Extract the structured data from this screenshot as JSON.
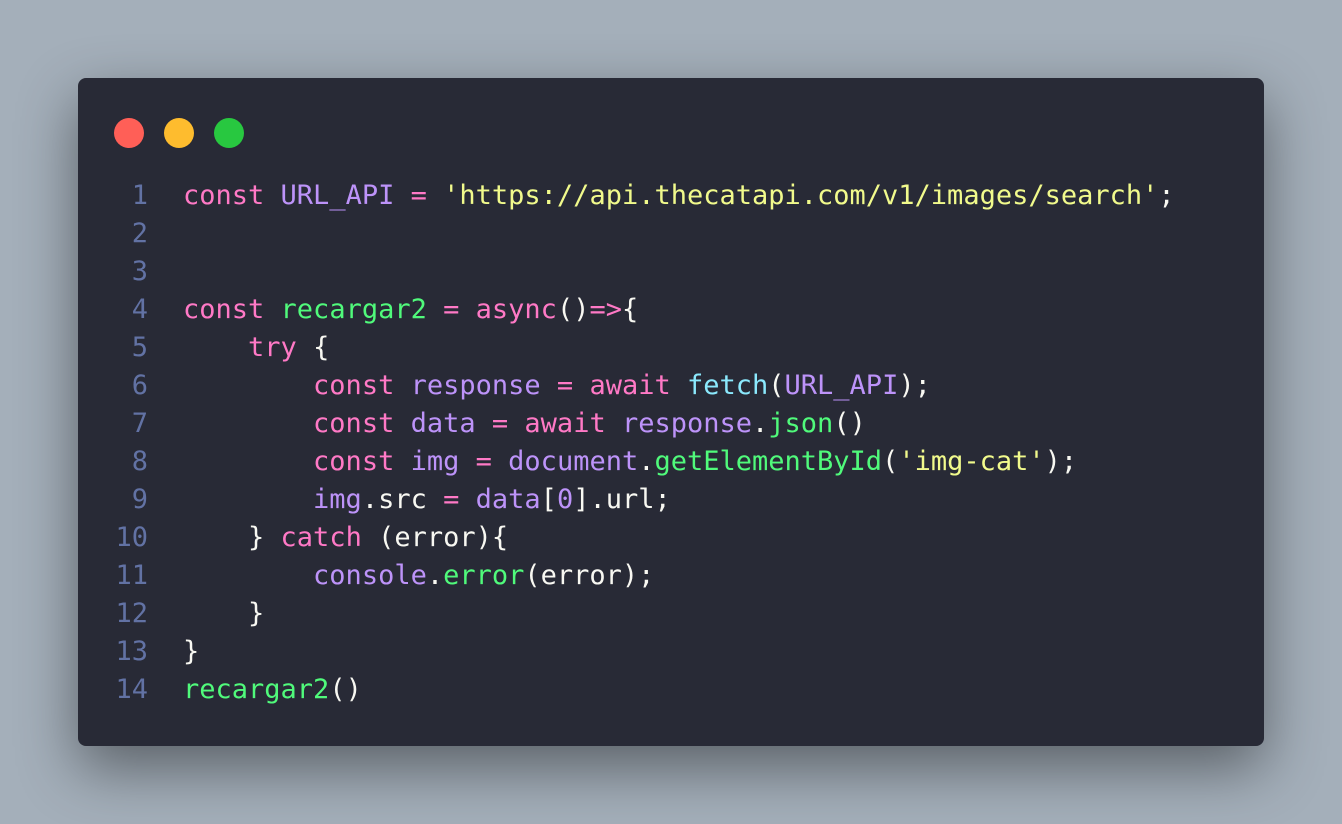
{
  "window": {
    "dots": [
      {
        "name": "close-dot",
        "color": "#ff5f57"
      },
      {
        "name": "minimize-dot",
        "color": "#febc2e"
      },
      {
        "name": "maximize-dot",
        "color": "#28c840"
      }
    ]
  },
  "theme": {
    "background": "#282a36",
    "line_number": "#6272a4",
    "default": "#f8f8f2",
    "keyword": "#ff79c6",
    "variable": "#bd93f9",
    "string": "#f1fa8c",
    "function": "#50fa7b",
    "builtin": "#8be9fd"
  },
  "code": {
    "lines": [
      {
        "n": "1",
        "tokens": [
          {
            "t": "const",
            "c": "keyword"
          },
          {
            "t": " ",
            "c": "default"
          },
          {
            "t": "URL_API",
            "c": "variable"
          },
          {
            "t": " ",
            "c": "default"
          },
          {
            "t": "=",
            "c": "keyword"
          },
          {
            "t": " ",
            "c": "default"
          },
          {
            "t": "'https://api.thecatapi.com/v1/images/search'",
            "c": "string"
          },
          {
            "t": ";",
            "c": "default"
          }
        ]
      },
      {
        "n": "2",
        "tokens": []
      },
      {
        "n": "3",
        "tokens": []
      },
      {
        "n": "4",
        "tokens": [
          {
            "t": "const",
            "c": "keyword"
          },
          {
            "t": " ",
            "c": "default"
          },
          {
            "t": "recargar2",
            "c": "function"
          },
          {
            "t": " ",
            "c": "default"
          },
          {
            "t": "=",
            "c": "keyword"
          },
          {
            "t": " ",
            "c": "default"
          },
          {
            "t": "async",
            "c": "keyword"
          },
          {
            "t": "()",
            "c": "default"
          },
          {
            "t": "=>",
            "c": "keyword"
          },
          {
            "t": "{",
            "c": "default"
          }
        ]
      },
      {
        "n": "5",
        "tokens": [
          {
            "t": "    ",
            "c": "default"
          },
          {
            "t": "try",
            "c": "keyword"
          },
          {
            "t": " {",
            "c": "default"
          }
        ]
      },
      {
        "n": "6",
        "tokens": [
          {
            "t": "        ",
            "c": "default"
          },
          {
            "t": "const",
            "c": "keyword"
          },
          {
            "t": " ",
            "c": "default"
          },
          {
            "t": "response",
            "c": "variable"
          },
          {
            "t": " ",
            "c": "default"
          },
          {
            "t": "=",
            "c": "keyword"
          },
          {
            "t": " ",
            "c": "default"
          },
          {
            "t": "await",
            "c": "keyword"
          },
          {
            "t": " ",
            "c": "default"
          },
          {
            "t": "fetch",
            "c": "builtin"
          },
          {
            "t": "(",
            "c": "default"
          },
          {
            "t": "URL_API",
            "c": "variable"
          },
          {
            "t": ");",
            "c": "default"
          }
        ]
      },
      {
        "n": "7",
        "tokens": [
          {
            "t": "        ",
            "c": "default"
          },
          {
            "t": "const",
            "c": "keyword"
          },
          {
            "t": " ",
            "c": "default"
          },
          {
            "t": "data",
            "c": "variable"
          },
          {
            "t": " ",
            "c": "default"
          },
          {
            "t": "=",
            "c": "keyword"
          },
          {
            "t": " ",
            "c": "default"
          },
          {
            "t": "await",
            "c": "keyword"
          },
          {
            "t": " ",
            "c": "default"
          },
          {
            "t": "response",
            "c": "variable"
          },
          {
            "t": ".",
            "c": "default"
          },
          {
            "t": "json",
            "c": "function"
          },
          {
            "t": "()",
            "c": "default"
          }
        ]
      },
      {
        "n": "8",
        "tokens": [
          {
            "t": "        ",
            "c": "default"
          },
          {
            "t": "const",
            "c": "keyword"
          },
          {
            "t": " ",
            "c": "default"
          },
          {
            "t": "img",
            "c": "variable"
          },
          {
            "t": " ",
            "c": "default"
          },
          {
            "t": "=",
            "c": "keyword"
          },
          {
            "t": " ",
            "c": "default"
          },
          {
            "t": "document",
            "c": "variable"
          },
          {
            "t": ".",
            "c": "default"
          },
          {
            "t": "getElementById",
            "c": "function"
          },
          {
            "t": "(",
            "c": "default"
          },
          {
            "t": "'img-cat'",
            "c": "string"
          },
          {
            "t": ");",
            "c": "default"
          }
        ]
      },
      {
        "n": "9",
        "tokens": [
          {
            "t": "        ",
            "c": "default"
          },
          {
            "t": "img",
            "c": "variable"
          },
          {
            "t": ".src ",
            "c": "default"
          },
          {
            "t": "=",
            "c": "keyword"
          },
          {
            "t": " ",
            "c": "default"
          },
          {
            "t": "data",
            "c": "variable"
          },
          {
            "t": "[",
            "c": "default"
          },
          {
            "t": "0",
            "c": "variable"
          },
          {
            "t": "].url;",
            "c": "default"
          }
        ]
      },
      {
        "n": "10",
        "tokens": [
          {
            "t": "    } ",
            "c": "default"
          },
          {
            "t": "catch",
            "c": "keyword"
          },
          {
            "t": " (error){",
            "c": "default"
          }
        ]
      },
      {
        "n": "11",
        "tokens": [
          {
            "t": "        ",
            "c": "default"
          },
          {
            "t": "console",
            "c": "variable"
          },
          {
            "t": ".",
            "c": "default"
          },
          {
            "t": "error",
            "c": "function"
          },
          {
            "t": "(error);",
            "c": "default"
          }
        ]
      },
      {
        "n": "12",
        "tokens": [
          {
            "t": "    }",
            "c": "default"
          }
        ]
      },
      {
        "n": "13",
        "tokens": [
          {
            "t": "}",
            "c": "default"
          }
        ]
      },
      {
        "n": "14",
        "tokens": [
          {
            "t": "recargar2",
            "c": "function"
          },
          {
            "t": "()",
            "c": "default"
          }
        ]
      }
    ]
  }
}
